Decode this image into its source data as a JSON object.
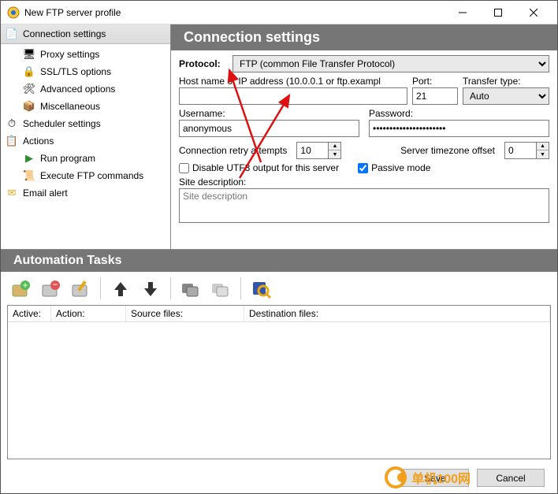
{
  "window": {
    "title": "New FTP server profile"
  },
  "sidebar": {
    "groups": [
      {
        "label": "Connection settings",
        "icon": "📄",
        "items": [
          {
            "label": "Proxy settings",
            "icon": "🔌"
          },
          {
            "label": "SSL/TLS options",
            "icon": "🔒"
          },
          {
            "label": "Advanced options",
            "icon": "⚙"
          },
          {
            "label": "Miscellaneous",
            "icon": "📦"
          }
        ]
      },
      {
        "label": "Scheduler settings",
        "icon": "⏰",
        "items": []
      },
      {
        "label": "Actions",
        "icon": "⚡",
        "items": [
          {
            "label": "Run program",
            "icon": "▶"
          },
          {
            "label": "Execute FTP commands",
            "icon": "📜"
          }
        ]
      },
      {
        "label": "Email alert",
        "icon": "✉",
        "items": []
      }
    ]
  },
  "conn": {
    "header": "Connection settings",
    "protocol_label": "Protocol:",
    "protocol_value": "FTP (common File Transfer Protocol)",
    "host_label": "Host name or IP address (10.0.0.1 or ftp.exampl",
    "host_value": "",
    "port_label": "Port:",
    "port_value": "21",
    "transfer_label": "Transfer type:",
    "transfer_value": "Auto",
    "user_label": "Username:",
    "user_value": "anonymous",
    "pass_label": "Password:",
    "pass_value": "••••••••••••••••••••••",
    "retry_label": "Connection retry attempts",
    "retry_value": "10",
    "tz_label": "Server timezone offset",
    "tz_value": "0",
    "disable_utf8_label": "Disable UTF8 output for this server",
    "disable_utf8_checked": false,
    "passive_label": "Passive mode",
    "passive_checked": true,
    "desc_label": "Site description:",
    "desc_placeholder": "Site description"
  },
  "tasks": {
    "header": "Automation Tasks",
    "columns": {
      "active": "Active:",
      "action": "Action:",
      "source": "Source files:",
      "dest": "Destination files:"
    }
  },
  "footer": {
    "save": "Save",
    "cancel": "Cancel"
  },
  "watermark": "单机100网"
}
